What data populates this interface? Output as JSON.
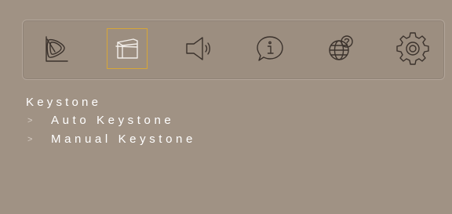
{
  "toolbar": {
    "icons": [
      {
        "name": "picture-icon",
        "selected": false
      },
      {
        "name": "display-keystone-icon",
        "selected": true
      },
      {
        "name": "audio-icon",
        "selected": false
      },
      {
        "name": "information-icon",
        "selected": false
      },
      {
        "name": "language-icon",
        "selected": false
      },
      {
        "name": "settings-icon",
        "selected": false
      }
    ],
    "selected_color": "#d7a637"
  },
  "menu": {
    "title": "Keystone",
    "items": [
      {
        "chevron": ">",
        "label": "Auto Keystone"
      },
      {
        "chevron": ">",
        "label": "Manual Keystone"
      }
    ]
  },
  "colors": {
    "background": "#a09284",
    "text": "#ffffff",
    "icon": "#3b322c"
  }
}
